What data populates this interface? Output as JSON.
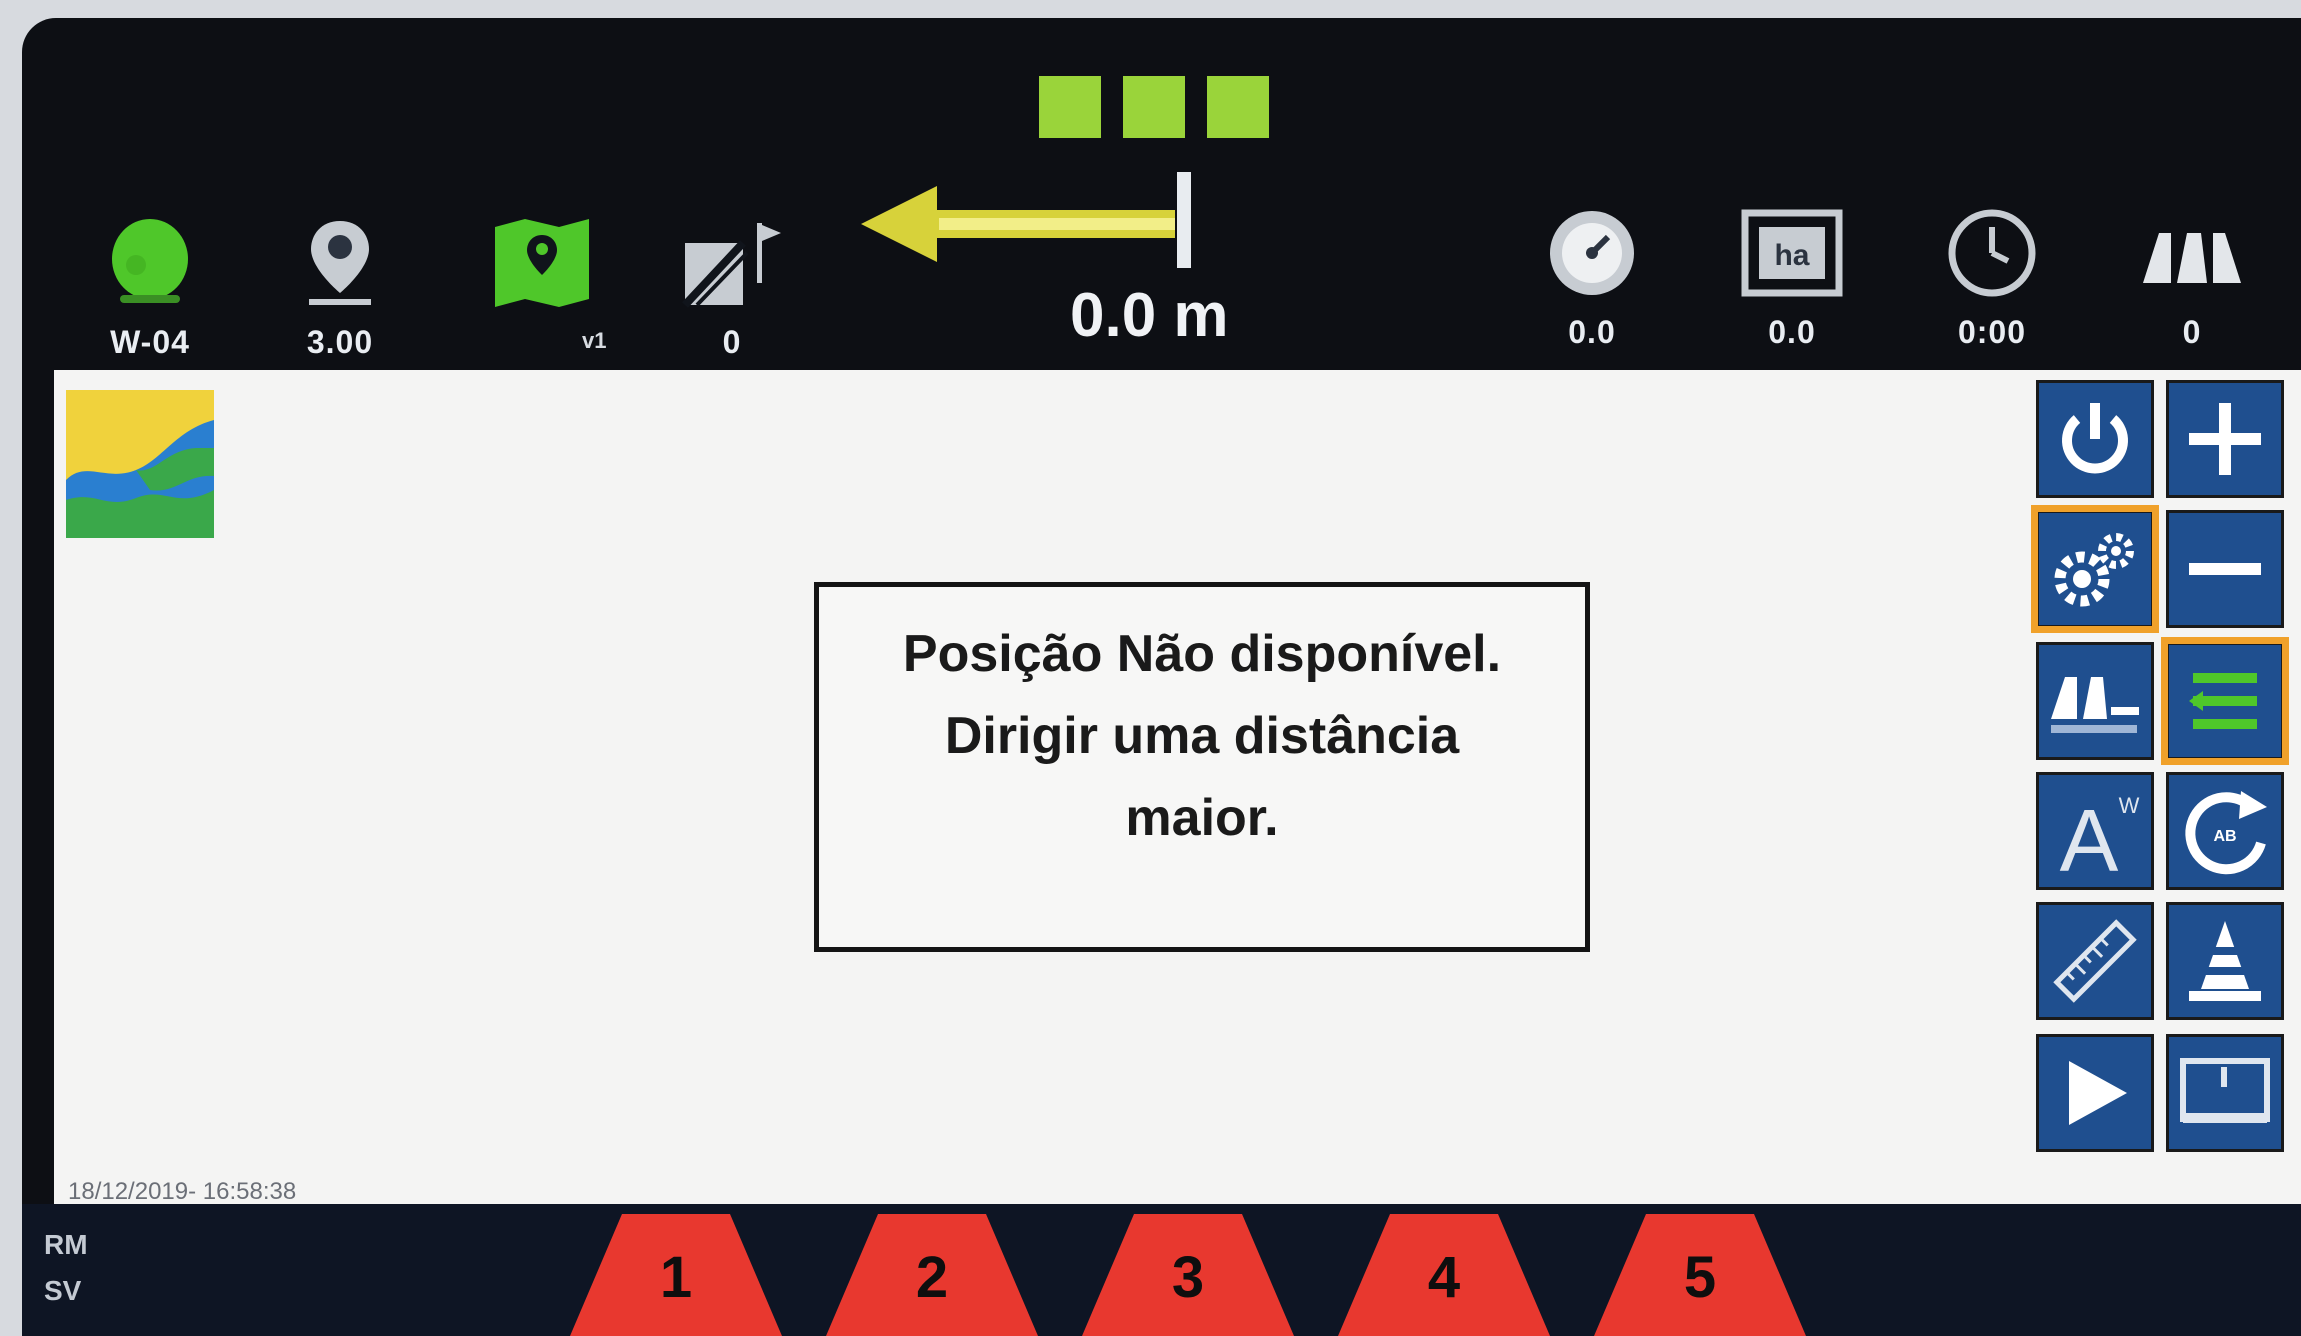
{
  "header": {
    "gps_bars": 3,
    "guidance_value": "0.0 m",
    "version_tag": "v1",
    "stats_left": [
      {
        "id": "vehicle",
        "icon": "vehicle-icon",
        "value": "W-04"
      },
      {
        "id": "width",
        "icon": "location-pin-icon",
        "value": "3.00"
      },
      {
        "id": "field-map",
        "icon": "field-map-icon",
        "value": ""
      },
      {
        "id": "guidance-lines",
        "icon": "guidance-lines-icon",
        "value": "0"
      }
    ],
    "stats_right": [
      {
        "id": "speed",
        "icon": "speedometer-icon",
        "value": "0.0"
      },
      {
        "id": "area",
        "icon": "hectare-icon",
        "value": "0.0"
      },
      {
        "id": "time",
        "icon": "clock-icon",
        "value": "0:00"
      },
      {
        "id": "sections",
        "icon": "sections-icon",
        "value": "0"
      }
    ]
  },
  "map": {
    "message": [
      "Posição Não disponível.",
      "Dirigir uma distância",
      "maior."
    ],
    "timestamp": "18/12/2019- 16:58:38"
  },
  "panel": {
    "buttons": [
      {
        "id": "power",
        "icon": "power-icon",
        "selected": false
      },
      {
        "id": "zoom-in",
        "icon": "plus-icon",
        "selected": false
      },
      {
        "id": "settings",
        "icon": "gears-icon",
        "selected": true
      },
      {
        "id": "zoom-out",
        "icon": "minus-icon",
        "selected": false
      },
      {
        "id": "section-control",
        "icon": "section-control-icon",
        "selected": false
      },
      {
        "id": "guidance-list",
        "icon": "guidance-list-icon",
        "selected": true
      },
      {
        "id": "auto-steer",
        "icon": "auto-steer-icon",
        "selected": false
      },
      {
        "id": "ab-line",
        "icon": "ab-refresh-icon",
        "selected": false
      },
      {
        "id": "ruler",
        "icon": "ruler-icon",
        "selected": false
      },
      {
        "id": "cone",
        "icon": "cone-icon",
        "selected": false
      },
      {
        "id": "play",
        "icon": "play-icon",
        "selected": false
      },
      {
        "id": "screen-view",
        "icon": "screen-view-icon",
        "selected": false
      }
    ]
  },
  "footer": {
    "mode_line1": "RM",
    "mode_line2": "SV",
    "sections": [
      "1",
      "2",
      "3",
      "4",
      "5"
    ],
    "section_color": "#e8382f"
  }
}
